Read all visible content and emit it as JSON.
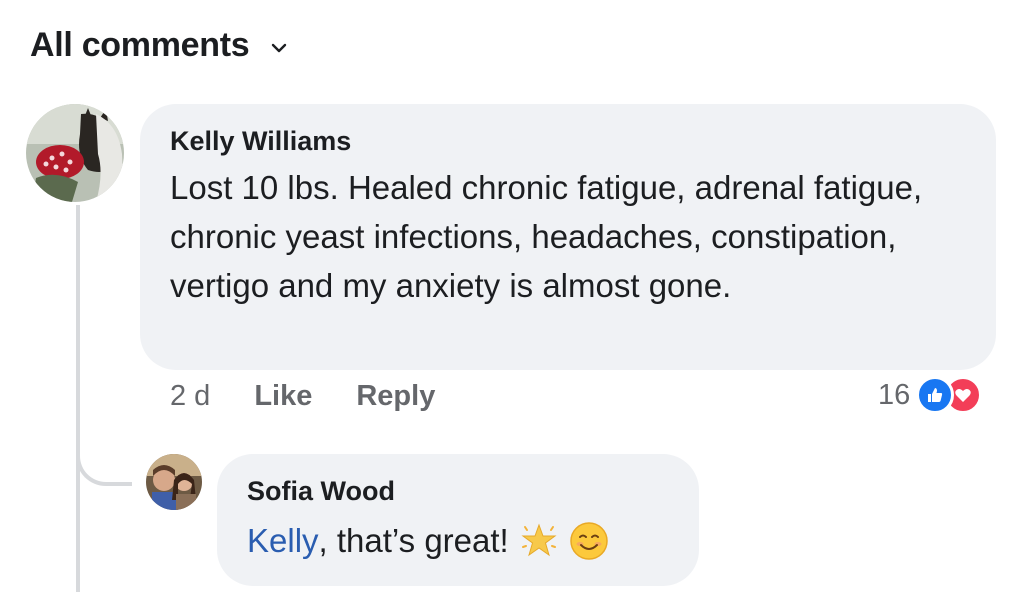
{
  "header": {
    "title": "All comments",
    "dropdown_icon": "chevron-down-icon"
  },
  "comments": [
    {
      "author": "Kelly Williams",
      "text": "Lost 10 lbs. Healed chronic fatigue, adrenal fatigue, chronic yeast infections, headaches, constipation, vertigo and my anxiety is almost gone.",
      "time": "2 d",
      "like_label": "Like",
      "reply_label": "Reply",
      "reaction_count": "16",
      "reactions": [
        "like-reaction-icon",
        "love-reaction-icon"
      ]
    }
  ],
  "replies": [
    {
      "author": "Sofia Wood",
      "mention": "Kelly",
      "text": ", that’s great!",
      "emojis": [
        "sparkle-star-icon",
        "smiling-face-icon"
      ]
    }
  ],
  "colors": {
    "bubble": "#f0f2f5",
    "meta_text": "#65676b",
    "mention": "#2a5db0",
    "like_blue": "#1877f2",
    "love_red": "#f33e58"
  }
}
